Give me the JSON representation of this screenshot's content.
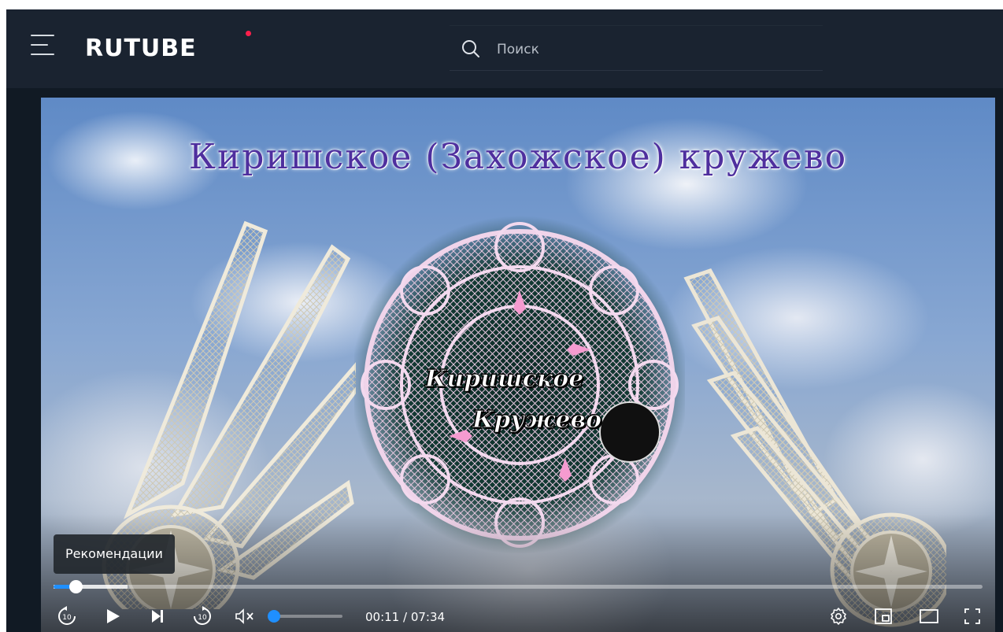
{
  "header": {
    "logo": "RUTUBE",
    "search": {
      "placeholder": "Поиск",
      "value": ""
    }
  },
  "video": {
    "title": "Киришское (Захожское) кружево",
    "logo_line1": "Киришское",
    "logo_line2": "Кружево"
  },
  "player": {
    "tooltip": "Рекомендации",
    "progress": 0.024,
    "buffered": 0.08,
    "volume": 0,
    "current_time": "00:11",
    "separator": " / ",
    "duration": "07:34",
    "accent_color": "#1f8fff"
  },
  "icons": [
    "menu-icon",
    "search-icon",
    "rewind-10-icon",
    "play-icon",
    "next-icon",
    "forward-10-icon",
    "mute-icon",
    "settings-icon",
    "mini-player-icon",
    "theater-mode-icon",
    "fullscreen-icon"
  ]
}
